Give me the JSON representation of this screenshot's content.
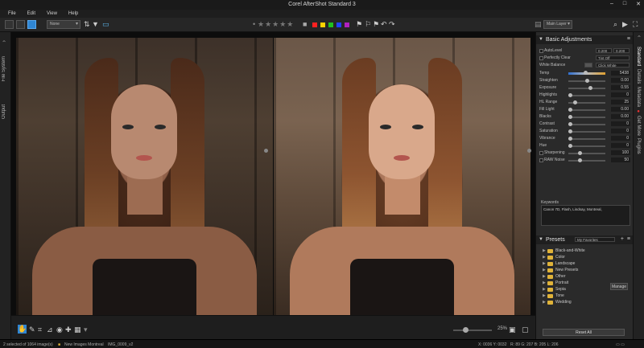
{
  "window": {
    "title": "Corel AfterShot Standard 3",
    "controls": [
      "–",
      "□",
      "✕"
    ]
  },
  "menu": [
    "File",
    "Edit",
    "View",
    "Help"
  ],
  "toolbar": {
    "view_select": "None",
    "stars": "★★★★★",
    "star_dot": "•",
    "color_labels": [
      "#ff2020",
      "#ffd200",
      "#20c020",
      "#2040ff",
      "#b020c0"
    ],
    "layer_select": "Main Layer"
  },
  "left_tabs": [
    "File System",
    "Output"
  ],
  "right_tabs": [
    "Standard",
    "Details",
    "Metadata",
    "Get More",
    "Plugins"
  ],
  "basic": {
    "title": "Basic Adjustments",
    "autolevel": {
      "label": "AutoLevel",
      "v1": "0.200",
      "v2": "0.200"
    },
    "perfectly_clear": {
      "label": "Perfectly Clear",
      "value": "Tint Off"
    },
    "white_balance": {
      "label": "White Balance",
      "value": "Click White"
    },
    "sliders": [
      {
        "label": "Temp",
        "value": "5438",
        "pos": 0.46,
        "kind": "temp"
      },
      {
        "label": "Straighten",
        "value": "0.00",
        "pos": 0.5
      },
      {
        "label": "Exposure",
        "value": "0.55",
        "pos": 0.6
      },
      {
        "label": "Highlights",
        "value": "0",
        "pos": 0.0
      },
      {
        "label": "HL Range",
        "value": "25",
        "pos": 0.15
      },
      {
        "label": "Fill Light",
        "value": "0.00",
        "pos": 0.0
      },
      {
        "label": "Blacks",
        "value": "0.00",
        "pos": 0.0
      },
      {
        "label": "Contrast",
        "value": "0",
        "pos": 0.0
      },
      {
        "label": "Saturation",
        "value": "0",
        "pos": 0.0
      },
      {
        "label": "Vibrance",
        "value": "0",
        "pos": 0.0
      },
      {
        "label": "Hue",
        "value": "0",
        "pos": 0.0
      },
      {
        "label": "Sharpening",
        "value": "100",
        "pos": 0.3,
        "check": true
      },
      {
        "label": "RAW Noise",
        "value": "50",
        "pos": 0.3,
        "check": true
      }
    ],
    "keywords_label": "Keywords",
    "keywords": "Canon 7D, Flash, Lindsay, Montreal,"
  },
  "presets": {
    "title": "Presets",
    "filter": "My Favorites",
    "items": [
      "Black-and-White",
      "Color",
      "Landscape",
      "New Presets",
      "Other",
      "Portrait",
      "Sepia",
      "Tone",
      "Wedding"
    ],
    "manage": "Manage",
    "reset": "Reset All"
  },
  "viewer": {
    "zoom": "25%",
    "zoom_pos": 0.3
  },
  "status": {
    "selection": "2 selected of 1064 image(s)",
    "folder": "New Images Montreal",
    "file": "IMG_0009_v2",
    "coords": "X: 0036  Y: 0032",
    "rgb": "R: 89   G: 207   B: 205   L: 206"
  }
}
